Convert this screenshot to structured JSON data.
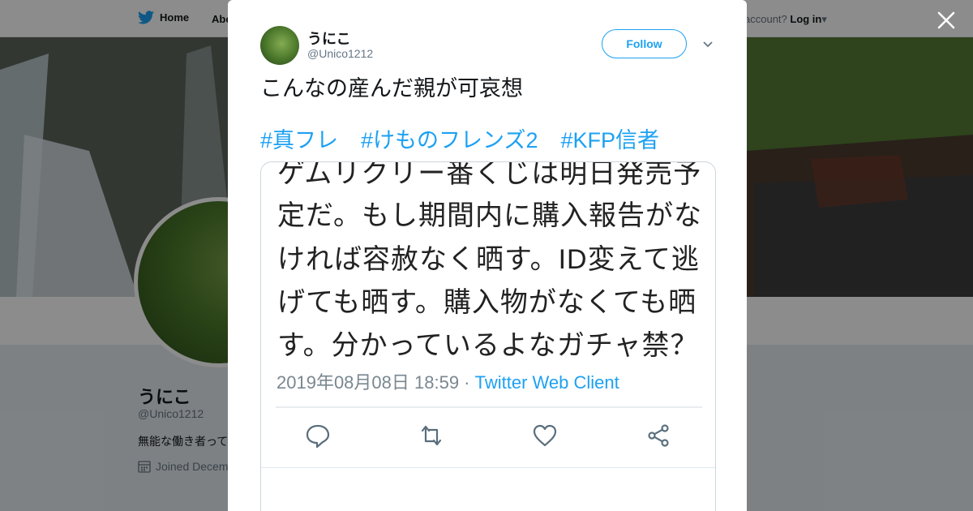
{
  "topbar": {
    "home_label": "Home",
    "about_label": "Abo",
    "login_prompt": "account? ",
    "login_label": "Log in"
  },
  "profile": {
    "name": "うにこ",
    "handle": "@Unico1212",
    "bio": "無能な働き者って",
    "joined": "Joined Decem"
  },
  "tweet": {
    "author_name": "うにこ",
    "author_handle": "@Unico1212",
    "follow_label": "Follow",
    "text": "こんなの産んだ親が可哀想",
    "hashtags": [
      "#真フレ",
      "#けものフレンズ2",
      "#KFP信者"
    ],
    "media": {
      "lines": [
        "ゲムリクリー番くじは明日発売予",
        "定だ。もし期間内に購入報告がな",
        "ければ容赦なく晒す。ID変えて逃",
        "げても晒す。購入物がなくても晒",
        "す。分かっているよなガチャ禁？"
      ],
      "timestamp": "2019年08月08日 18:59 · ",
      "client": "Twitter Web Client"
    }
  },
  "icons": [
    "twitter-bird-icon",
    "caret-down-icon",
    "close-icon",
    "calendar-icon",
    "reply-icon",
    "retweet-icon",
    "like-icon",
    "share-icon"
  ],
  "colors": {
    "accent": "#1da1f2",
    "text": "#14171a",
    "secondary": "#657786"
  }
}
